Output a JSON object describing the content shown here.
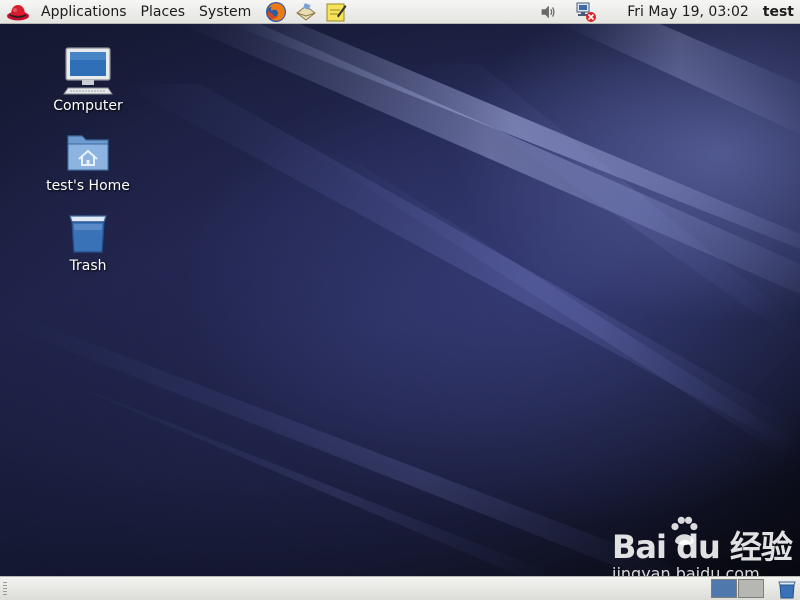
{
  "top_panel": {
    "menus": [
      {
        "label": "Applications"
      },
      {
        "label": "Places"
      },
      {
        "label": "System"
      }
    ],
    "launchers": [
      "firefox-icon",
      "mail-icon",
      "notes-icon"
    ],
    "tray": [
      "volume-icon",
      "network-disconnected-icon"
    ],
    "clock": "Fri May 19, 03:02",
    "user": "test"
  },
  "desktop": {
    "icons": [
      {
        "label": "Computer",
        "icon": "computer-icon"
      },
      {
        "label": "test's Home",
        "icon": "home-folder-icon"
      },
      {
        "label": "Trash",
        "icon": "trash-icon"
      }
    ]
  },
  "watermark": {
    "brand": "Bai du 经验",
    "site": "jingyan.baidu.com"
  },
  "bottom_panel": {
    "workspaces": 2,
    "active_workspace": 1
  },
  "colors": {
    "panel": "#ececea",
    "accent": "#4f78ad",
    "desktop_bg": "#1d2145"
  }
}
